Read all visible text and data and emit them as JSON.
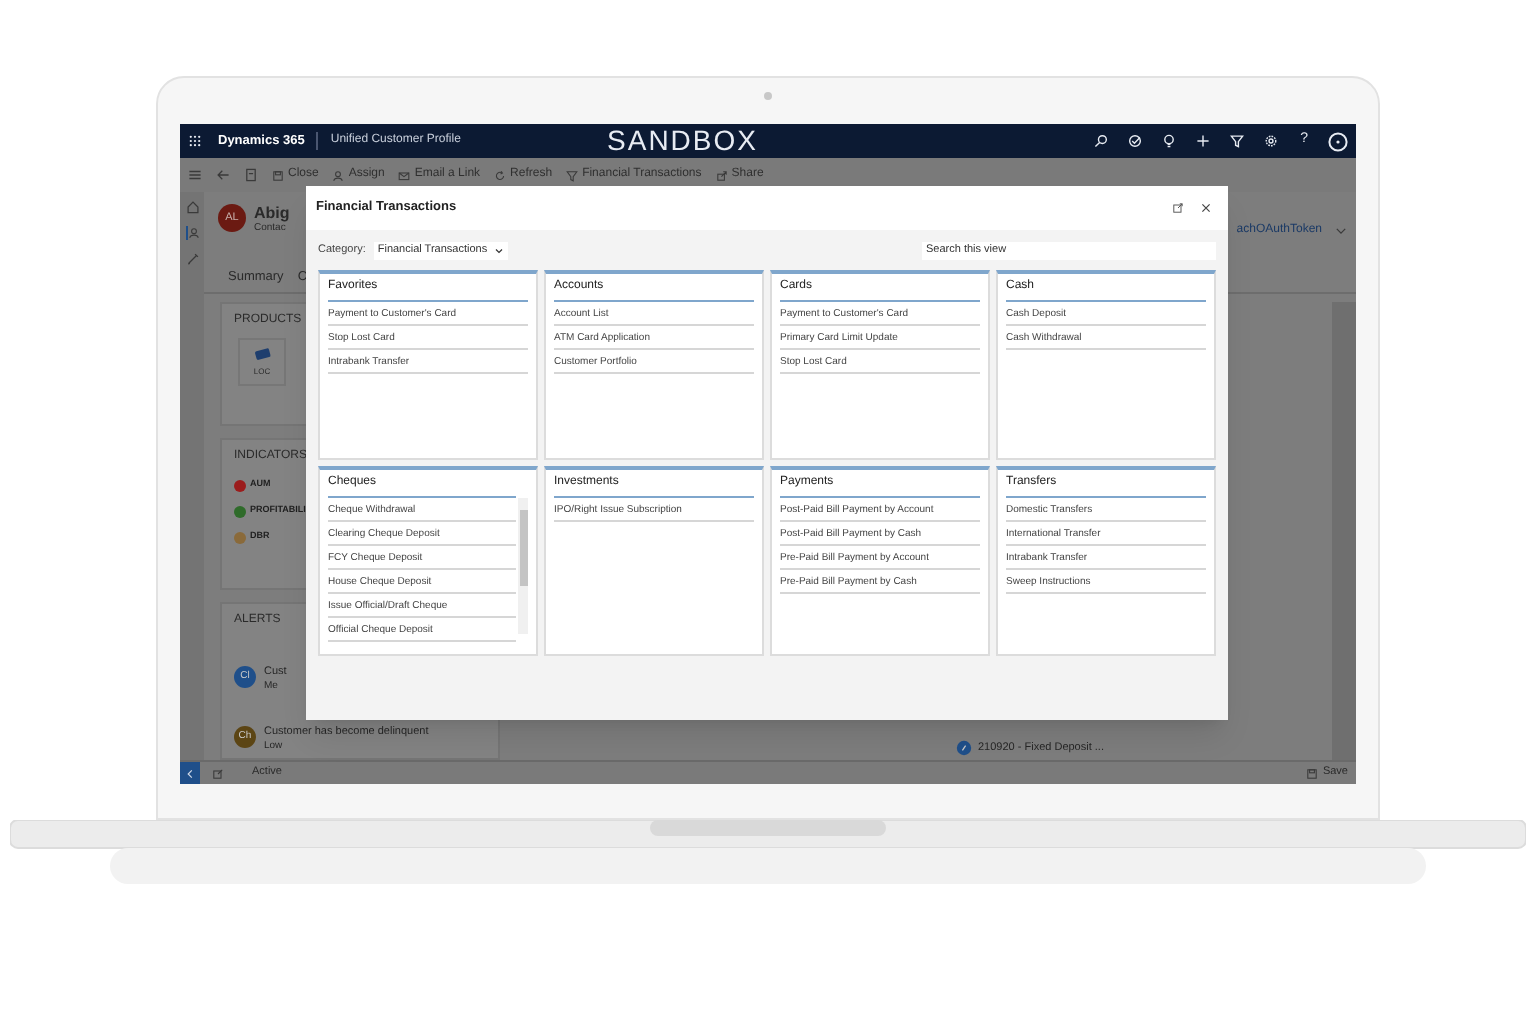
{
  "app_bar": {
    "app_name": "Dynamics 365",
    "area": "Unified Customer Profile",
    "environment": "SANDBOX",
    "help": "?"
  },
  "command_bar": [
    {
      "label": "Close"
    },
    {
      "label": "Assign"
    },
    {
      "label": "Email a Link"
    },
    {
      "label": "Refresh"
    },
    {
      "label": "Financial Transactions"
    },
    {
      "label": "Share"
    }
  ],
  "record": {
    "initials": "AL",
    "name": "Abig",
    "subtitle": "Contac",
    "tabs": [
      "Summary",
      "C"
    ],
    "link": "achOAuthToken"
  },
  "products": {
    "title": "PRODUCTS",
    "items": [
      "LOC"
    ]
  },
  "indicators": {
    "title": "INDICATORS",
    "items": [
      {
        "label": "AUM",
        "color": "#9b1c1c"
      },
      {
        "label": "PROFITABILI",
        "color": "#2f6b2a"
      },
      {
        "label": "DBR",
        "color": "#8a6a3a"
      }
    ]
  },
  "alerts": {
    "title": "ALERTS",
    "items": [
      {
        "initials": "Cl",
        "title": "Cust",
        "subtitle": "Me",
        "color": "#1f4f8a"
      },
      {
        "initials": "Ch",
        "title": "Customer has become delinquent",
        "subtitle": "Low",
        "color": "#5c4514"
      }
    ]
  },
  "timeline_item": {
    "text": "210920 - Fixed Deposit ..."
  },
  "status_bar": {
    "status": "Active",
    "save": "Save"
  },
  "dialog": {
    "title": "Financial Transactions",
    "category_label": "Category:",
    "category": "Financial Transactions",
    "search_placeholder": "Search this view",
    "groups": [
      {
        "title": "Favorites",
        "scrollable": false,
        "items": [
          "Payment to Customer's Card",
          "Stop Lost Card",
          "Intrabank Transfer"
        ]
      },
      {
        "title": "Accounts",
        "scrollable": false,
        "items": [
          "Account List",
          "ATM Card Application",
          "Customer Portfolio"
        ]
      },
      {
        "title": "Cards",
        "scrollable": false,
        "items": [
          "Payment to Customer's Card",
          "Primary Card Limit Update",
          "Stop Lost Card"
        ]
      },
      {
        "title": "Cash",
        "scrollable": false,
        "items": [
          "Cash Deposit",
          "Cash Withdrawal"
        ]
      },
      {
        "title": "Cheques",
        "scrollable": true,
        "items": [
          "Cheque Withdrawal",
          "Clearing Cheque Deposit",
          "FCY Cheque Deposit",
          "House Cheque Deposit",
          "Issue Official/Draft Cheque",
          "Official Cheque Deposit"
        ]
      },
      {
        "title": "Investments",
        "scrollable": false,
        "items": [
          "IPO/Right Issue Subscription"
        ]
      },
      {
        "title": "Payments",
        "scrollable": false,
        "items": [
          "Post-Paid Bill Payment by Account",
          "Post-Paid Bill Payment by Cash",
          "Pre-Paid Bill Payment by Account",
          "Pre-Paid Bill Payment by Cash"
        ]
      },
      {
        "title": "Transfers",
        "scrollable": false,
        "items": [
          "Domestic Transfers",
          "International Transfer",
          "Intrabank Transfer",
          "Sweep Instructions"
        ]
      }
    ]
  }
}
